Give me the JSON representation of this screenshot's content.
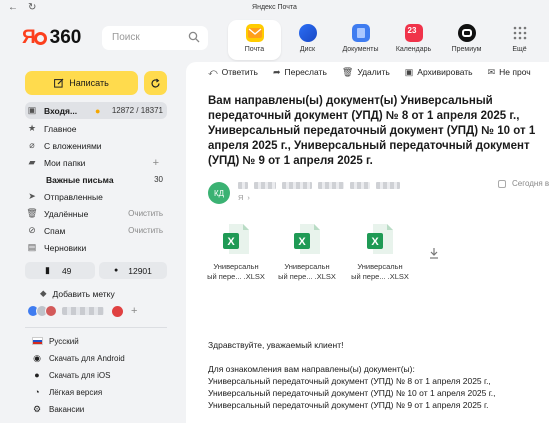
{
  "window": {
    "title": "Яндекс Почта"
  },
  "header": {
    "logo_ya": "Я",
    "logo_360": "360",
    "search_placeholder": "Поиск",
    "apps": [
      {
        "label": "Почта"
      },
      {
        "label": "Диск"
      },
      {
        "label": "Документы"
      },
      {
        "label": "Календарь",
        "badge": "23"
      },
      {
        "label": "Премиум"
      },
      {
        "label": "Ещё"
      }
    ]
  },
  "sidebar": {
    "compose_label": "Написать",
    "folders": [
      {
        "label": "Входя...",
        "count": "12872 / 18371"
      },
      {
        "label": "Главное"
      },
      {
        "label": "С вложениями"
      },
      {
        "label": "Мои папки"
      },
      {
        "label": "Важные письма",
        "count": "30"
      },
      {
        "label": "Отправленные"
      },
      {
        "label": "Удалённые",
        "action": "Очистить"
      },
      {
        "label": "Спам",
        "action": "Очистить"
      },
      {
        "label": "Черновики"
      }
    ],
    "bookmarks_count": "49",
    "unread_count": "12901",
    "add_label": "Добавить метку",
    "extras": [
      {
        "label": "Русский"
      },
      {
        "label": "Скачать для Android"
      },
      {
        "label": "Скачать для iOS"
      },
      {
        "label": "Лёгкая версия"
      },
      {
        "label": "Вакансии"
      }
    ]
  },
  "toolbar": {
    "reply": "Ответить",
    "forward": "Переслать",
    "delete": "Удалить",
    "archive": "Архивировать",
    "not_spam": "Не проч"
  },
  "message": {
    "subject": "Вам направлены(ы) документ(ы) Универсальный передаточный документ (УПД) № 8 от 1 апреля 2025 г., Универсальный передаточный документ (УПД) № 10 от 1 апреля 2025 г., Универсальный передаточный документ (УПД) № 9 от 1 апреля 2025 г.",
    "sender_initials": "КД",
    "to_prefix": "Я",
    "date": "Сегодня в...",
    "attachments": [
      {
        "line1": "Универсальн",
        "line2": "ый пере... .XLSX"
      },
      {
        "line1": "Универсальн",
        "line2": "ый пере... .XLSX"
      },
      {
        "line1": "Универсальн",
        "line2": "ый пере... .XLSX"
      }
    ],
    "greeting": "Здравствуйте, уважаемый клиент!",
    "intro": "Для ознакомления вам направлены(ы) документ(ы):",
    "lines": [
      "Универсальный передаточный документ (УПД) № 8 от 1 апреля 2025 г.,",
      "Универсальный передаточный документ (УПД) № 10 от 1 апреля 2025 г.,",
      "Универсальный передаточный документ (УПД) № 9 от 1 апреля 2025 г."
    ]
  },
  "colors": {
    "accent_yellow": "#ffdb4d",
    "brand_red": "#fc3f1d",
    "excel_green": "#1f9a55"
  }
}
